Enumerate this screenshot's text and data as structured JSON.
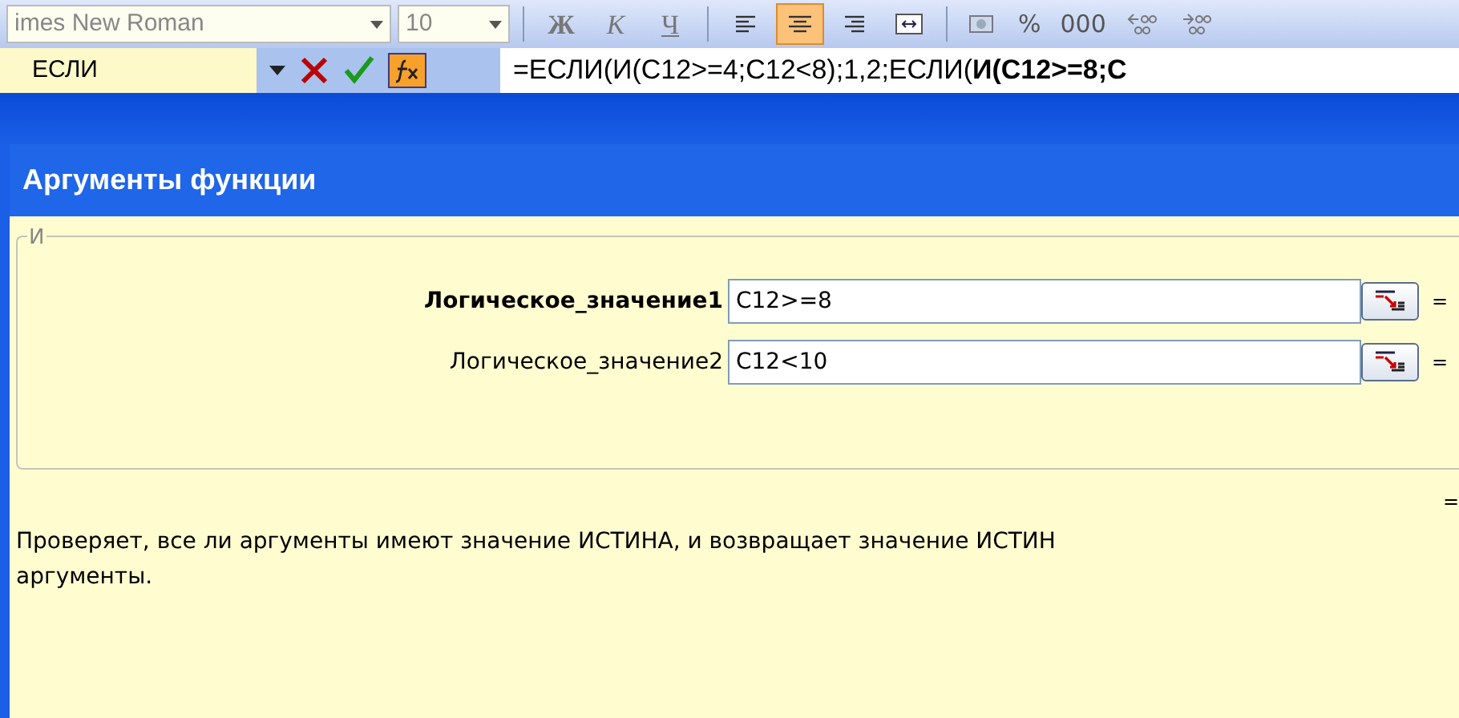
{
  "toolbar": {
    "font": "imes New Roman",
    "size": "10",
    "format_buttons": [
      {
        "label": "Ж",
        "kind": "bold"
      },
      {
        "label": "К",
        "kind": "italic"
      },
      {
        "label": "Ч",
        "kind": "underline"
      }
    ],
    "align_buttons": [
      {
        "kind": "left",
        "selected": false
      },
      {
        "kind": "center",
        "selected": true
      },
      {
        "kind": "right",
        "selected": false
      },
      {
        "kind": "merge",
        "selected": false
      }
    ],
    "number_buttons": [
      {
        "kind": "currency"
      },
      {
        "kind": "text",
        "label": "%"
      },
      {
        "kind": "text",
        "label": "000"
      },
      {
        "kind": "increase"
      },
      {
        "kind": "decrease"
      }
    ]
  },
  "formula_bar": {
    "name_box": "ЕСЛИ",
    "formula": "=ЕСЛИ(И(C12>=4;C12<8);1,2;ЕСЛИ(**И(C12>=8;C**"
  },
  "dialog": {
    "title": "Аргументы функции",
    "group": "И",
    "arguments": [
      {
        "label": "Логическое_значение1",
        "active": true,
        "value": "C12>=8",
        "result": "="
      },
      {
        "label": "Логическое_значение2",
        "active": false,
        "value": "C12<10",
        "result": "="
      }
    ],
    "total": "=",
    "description": "Проверяет, все ли аргументы имеют значение ИСТИНА, и возвращает значение ИСТИН",
    "description_line2": "аргументы."
  }
}
